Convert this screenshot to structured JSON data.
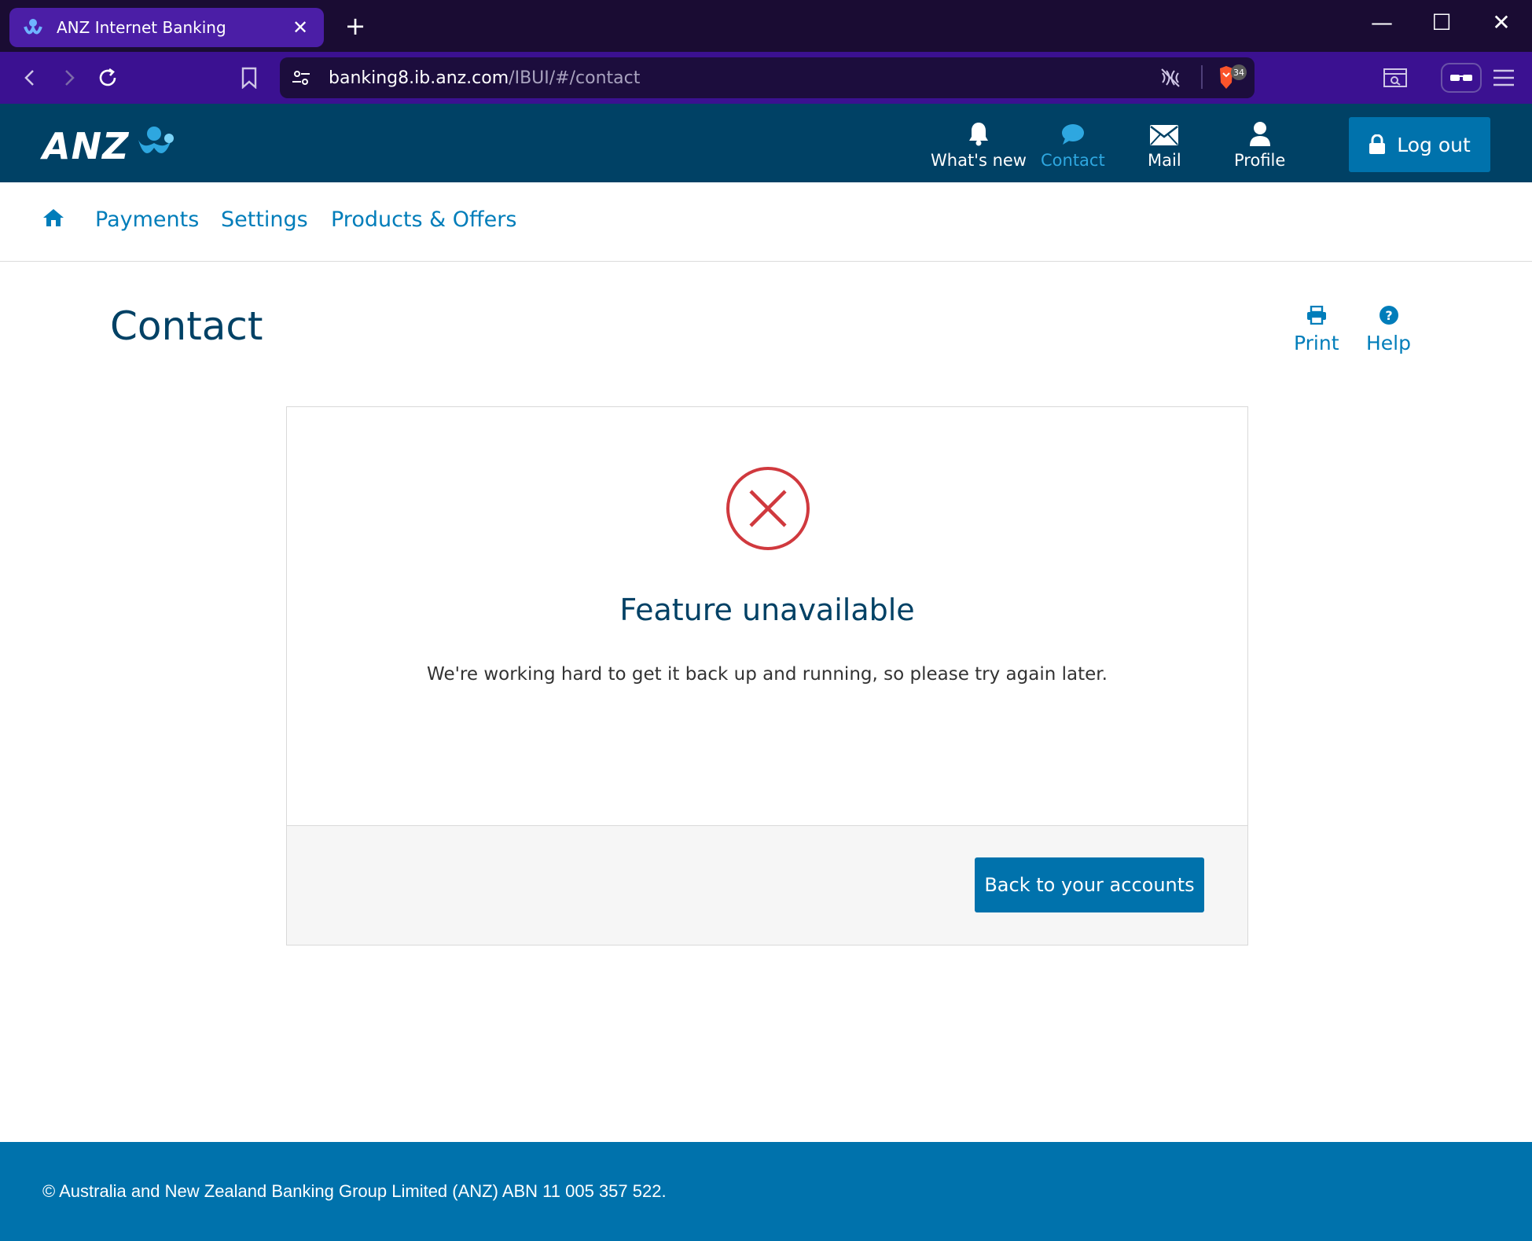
{
  "browser": {
    "tab_title": "ANZ Internet Banking",
    "tab_close": "✕",
    "new_tab": "+",
    "url_host": "banking8.ib.anz.com",
    "url_path": "/IBUI/#/contact",
    "shield_count": "34",
    "window_min": "—",
    "window_max": "☐",
    "window_close": "✕"
  },
  "header": {
    "logo_text": "ANZ",
    "items": [
      {
        "label": "What's new",
        "icon": "bell-icon"
      },
      {
        "label": "Contact",
        "icon": "chat-bubble-icon",
        "active": true
      },
      {
        "label": "Mail",
        "icon": "envelope-icon"
      },
      {
        "label": "Profile",
        "icon": "person-icon"
      }
    ],
    "logout_label": "Log out"
  },
  "subnav": {
    "items": [
      "Payments",
      "Settings",
      "Products & Offers"
    ]
  },
  "page": {
    "title": "Contact",
    "print_label": "Print",
    "help_label": "Help"
  },
  "card": {
    "heading": "Feature unavailable",
    "message": "We're working hard to get it back up and running, so please try again later.",
    "button_label": "Back to your accounts"
  },
  "footer": {
    "text": "© Australia and New Zealand Banking Group Limited (ANZ) ABN 11 005 357 522."
  },
  "colors": {
    "header_bg": "#004165",
    "accent": "#0072ac",
    "link": "#007dba",
    "error": "#d0393e",
    "browser_tab": "#4b1ea6",
    "browser_toolbar": "#3b1191"
  }
}
